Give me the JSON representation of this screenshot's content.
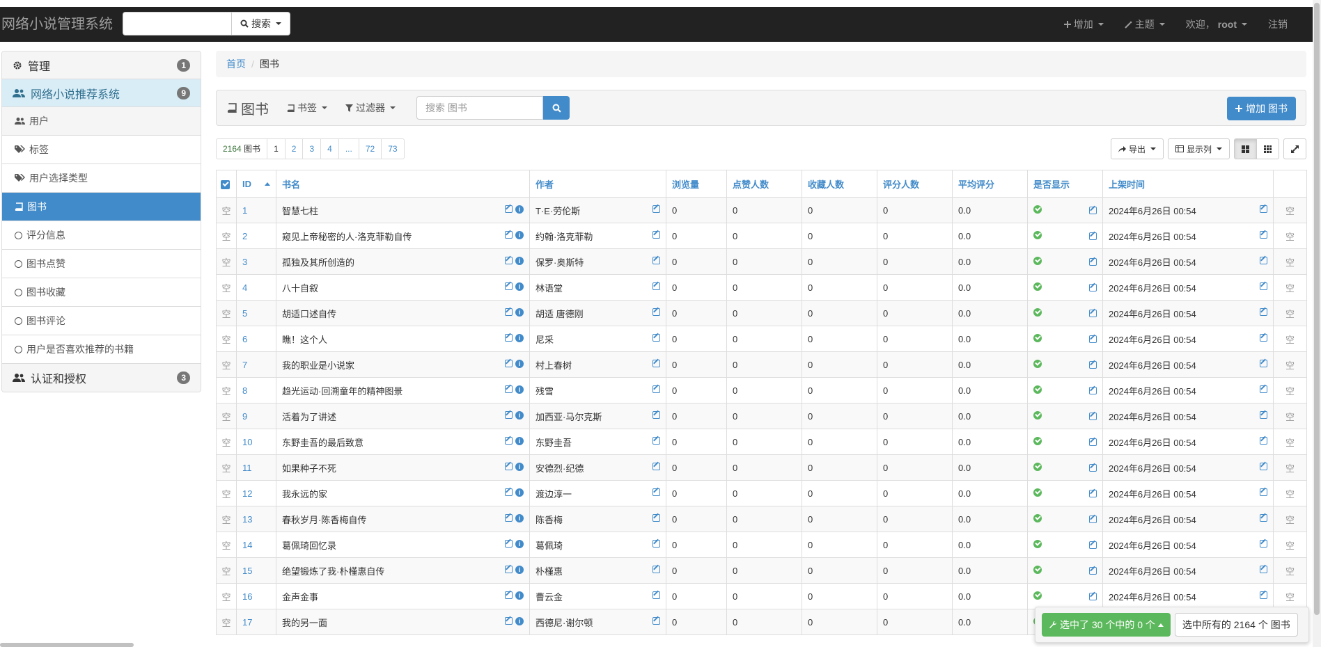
{
  "navbar": {
    "brand": "网络小说管理系统",
    "search_label": "搜索",
    "add_label": "增加",
    "theme_label": "主题",
    "welcome_label": "欢迎，",
    "user_label": "root",
    "logout_label": "注销"
  },
  "sidebar": {
    "manage": {
      "label": "管理",
      "count": "1"
    },
    "system": {
      "label": "网络小说推荐系统",
      "count": "9"
    },
    "items": [
      {
        "label": "用户"
      },
      {
        "label": "标签"
      },
      {
        "label": "用户选择类型"
      },
      {
        "label": "图书"
      },
      {
        "label": "评分信息"
      },
      {
        "label": "图书点赞"
      },
      {
        "label": "图书收藏"
      },
      {
        "label": "图书评论"
      },
      {
        "label": "用户是否喜欢推荐的书籍"
      }
    ],
    "auth": {
      "label": "认证和授权",
      "count": "3"
    }
  },
  "breadcrumb": {
    "home": "首页",
    "current": "图书"
  },
  "toolbox": {
    "title": "图书",
    "bookmark_label": "书签",
    "filter_label": "过滤器",
    "search_placeholder": "搜索 图书",
    "add_button": "增加 图书"
  },
  "pager": {
    "count": "2164",
    "count_unit": "图书",
    "pages": [
      "1",
      "2",
      "3",
      "4",
      "...",
      "72",
      "73"
    ]
  },
  "tools": {
    "export_label": "导出",
    "columns_label": "显示列"
  },
  "table": {
    "headers": [
      "ID",
      "书名",
      "作者",
      "浏览量",
      "点赞人数",
      "收藏人数",
      "评分人数",
      "平均评分",
      "是否显示",
      "上架时间"
    ],
    "empty_mark": "空",
    "rows": [
      {
        "id": "1",
        "title": "智慧七柱",
        "author": "T·E·劳伦斯",
        "views": "0",
        "likes": "0",
        "favs": "0",
        "raters": "0",
        "avg": "0.0",
        "time": "2024年6月26日 00:54"
      },
      {
        "id": "2",
        "title": "窥见上帝秘密的人·洛克菲勒自传",
        "author": "约翰·洛克菲勒",
        "views": "0",
        "likes": "0",
        "favs": "0",
        "raters": "0",
        "avg": "0.0",
        "time": "2024年6月26日 00:54"
      },
      {
        "id": "3",
        "title": "孤独及其所创造的",
        "author": "保罗·奥斯特",
        "views": "0",
        "likes": "0",
        "favs": "0",
        "raters": "0",
        "avg": "0.0",
        "time": "2024年6月26日 00:54"
      },
      {
        "id": "4",
        "title": "八十自叙",
        "author": "林语堂",
        "views": "0",
        "likes": "0",
        "favs": "0",
        "raters": "0",
        "avg": "0.0",
        "time": "2024年6月26日 00:54"
      },
      {
        "id": "5",
        "title": "胡适口述自传",
        "author": "胡适 唐德刚",
        "views": "0",
        "likes": "0",
        "favs": "0",
        "raters": "0",
        "avg": "0.0",
        "time": "2024年6月26日 00:54"
      },
      {
        "id": "6",
        "title": "瞧！这个人",
        "author": "尼采",
        "views": "0",
        "likes": "0",
        "favs": "0",
        "raters": "0",
        "avg": "0.0",
        "time": "2024年6月26日 00:54"
      },
      {
        "id": "7",
        "title": "我的职业是小说家",
        "author": "村上春树",
        "views": "0",
        "likes": "0",
        "favs": "0",
        "raters": "0",
        "avg": "0.0",
        "time": "2024年6月26日 00:54"
      },
      {
        "id": "8",
        "title": "趋光运动·回溯童年的精神图景",
        "author": "残雪",
        "views": "0",
        "likes": "0",
        "favs": "0",
        "raters": "0",
        "avg": "0.0",
        "time": "2024年6月26日 00:54"
      },
      {
        "id": "9",
        "title": "活着为了讲述",
        "author": "加西亚·马尔克斯",
        "views": "0",
        "likes": "0",
        "favs": "0",
        "raters": "0",
        "avg": "0.0",
        "time": "2024年6月26日 00:54"
      },
      {
        "id": "10",
        "title": "东野圭吾的最后致意",
        "author": "东野圭吾",
        "views": "0",
        "likes": "0",
        "favs": "0",
        "raters": "0",
        "avg": "0.0",
        "time": "2024年6月26日 00:54"
      },
      {
        "id": "11",
        "title": "如果种子不死",
        "author": "安德烈·纪德",
        "views": "0",
        "likes": "0",
        "favs": "0",
        "raters": "0",
        "avg": "0.0",
        "time": "2024年6月26日 00:54"
      },
      {
        "id": "12",
        "title": "我永远的家",
        "author": "渡边淳一",
        "views": "0",
        "likes": "0",
        "favs": "0",
        "raters": "0",
        "avg": "0.0",
        "time": "2024年6月26日 00:54"
      },
      {
        "id": "13",
        "title": "春秋岁月·陈香梅自传",
        "author": "陈香梅",
        "views": "0",
        "likes": "0",
        "favs": "0",
        "raters": "0",
        "avg": "0.0",
        "time": "2024年6月26日 00:54"
      },
      {
        "id": "14",
        "title": "葛佩琦回忆录",
        "author": "葛佩琦",
        "views": "0",
        "likes": "0",
        "favs": "0",
        "raters": "0",
        "avg": "0.0",
        "time": "2024年6月26日 00:54"
      },
      {
        "id": "15",
        "title": "绝望锻炼了我·朴槿惠自传",
        "author": "朴槿惠",
        "views": "0",
        "likes": "0",
        "favs": "0",
        "raters": "0",
        "avg": "0.0",
        "time": "2024年6月26日 00:54"
      },
      {
        "id": "16",
        "title": "金声金事",
        "author": "曹云金",
        "views": "0",
        "likes": "0",
        "favs": "0",
        "raters": "0",
        "avg": "0.0",
        "time": "2024年6月26日 00:54"
      },
      {
        "id": "17",
        "title": "我的另一面",
        "author": "西德尼·谢尔顿",
        "views": "0",
        "likes": "0",
        "favs": "0",
        "raters": "0",
        "avg": "0.0",
        "time": "2024年6月26日 00:54"
      }
    ]
  },
  "selection_bar": {
    "selected_label": "选中了 30 个中的 0 个",
    "select_all_label": "选中所有的 2164 个 图书"
  }
}
